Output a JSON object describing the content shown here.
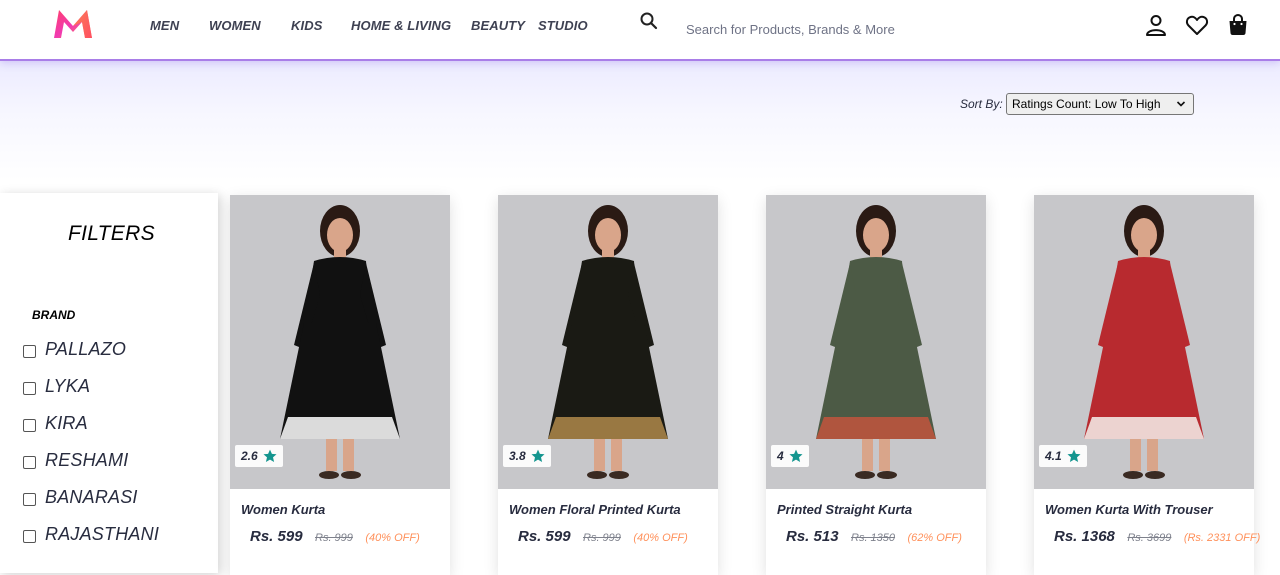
{
  "header": {
    "nav": [
      "MEN",
      "WOMEN",
      "KIDS",
      "HOME & LIVING",
      "BEAUTY",
      "STUDIO"
    ],
    "search_placeholder": "Search for Products, Brands & More",
    "icons": [
      "search-icon",
      "profile-icon",
      "wishlist-heart-icon",
      "bag-icon"
    ]
  },
  "sort": {
    "label": "Sort By:",
    "selected": "Ratings Count: Low To High"
  },
  "filters": {
    "title": "FILTERS",
    "brand_title": "BRAND",
    "brands": [
      "PALLAZO",
      "LYKA",
      "KIRA",
      "RESHAMI",
      "BANARASI",
      "RAJASTHANI"
    ]
  },
  "products": [
    {
      "name": "Women Kurta",
      "rating": "2.6",
      "price": "Rs. 599",
      "mrp": "Rs. 999",
      "discount": "(40% OFF)",
      "dress_color": "#111111",
      "accent_color": "#ffffff"
    },
    {
      "name": "Women Floral Printed Kurta",
      "rating": "3.8",
      "price": "Rs. 599",
      "mrp": "Rs. 999",
      "discount": "(40% OFF)",
      "dress_color": "#1a1a14",
      "accent_color": "#b0894a"
    },
    {
      "name": "Printed Straight Kurta",
      "rating": "4",
      "price": "Rs. 513",
      "mrp": "Rs. 1350",
      "discount": "(62% OFF)",
      "dress_color": "#4c5a45",
      "accent_color": "#c2553d"
    },
    {
      "name": "Women Kurta With Trouser",
      "rating": "4.1",
      "price": "Rs. 1368",
      "mrp": "Rs. 3699",
      "discount": "(Rs. 2331 OFF)",
      "dress_color": "#b82a2f",
      "accent_color": "#f4f1ec"
    }
  ],
  "colors": {
    "accent": "#a97de8",
    "star": "#14958f",
    "discount": "#ff905a",
    "text": "#282c3f"
  }
}
